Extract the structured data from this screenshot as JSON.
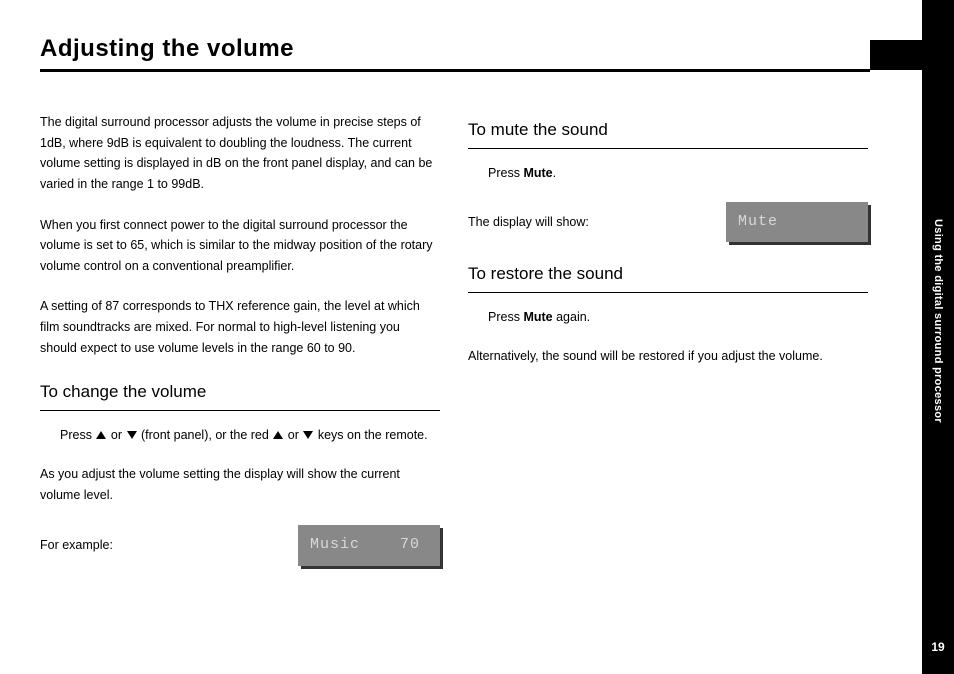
{
  "page": {
    "title": "Adjusting the volume",
    "number": "19",
    "sidebar_label": "Using the digital surround processor"
  },
  "left": {
    "p1": "The digital surround processor adjusts the volume in precise steps of 1dB, where 9dB is equivalent to doubling the loudness. The current volume setting is displayed in dB on the front panel display, and can be varied in the range 1 to 99dB.",
    "p2": "When you first connect power to the digital surround processor the volume is set to 65, which is similar to the midway position of the rotary volume control on a conventional preamplifier.",
    "p3": "A setting of 87 corresponds to THX reference gain, the level at which film soundtracks are mixed. For normal to high-level listening you should expect to use volume levels in the range 60 to 90.",
    "sub1": "To change the volume",
    "press_pre": "Press ",
    "press_mid1": " or ",
    "press_mid2": " (front panel), or the red ",
    "press_mid3": " or ",
    "press_post": " keys on the remote.",
    "p4": "As you adjust the volume setting the display will show the current volume level.",
    "for_example": "For example:",
    "lcd1": "Music    70"
  },
  "right": {
    "sub1": "To mute the sound",
    "press_label": "Press ",
    "mute": "Mute",
    "period": ".",
    "display_show": "The display will show:",
    "lcd2": "Mute",
    "sub2": "To restore the sound",
    "again": " again.",
    "p_alt": "Alternatively, the sound will be restored if you adjust the volume."
  }
}
